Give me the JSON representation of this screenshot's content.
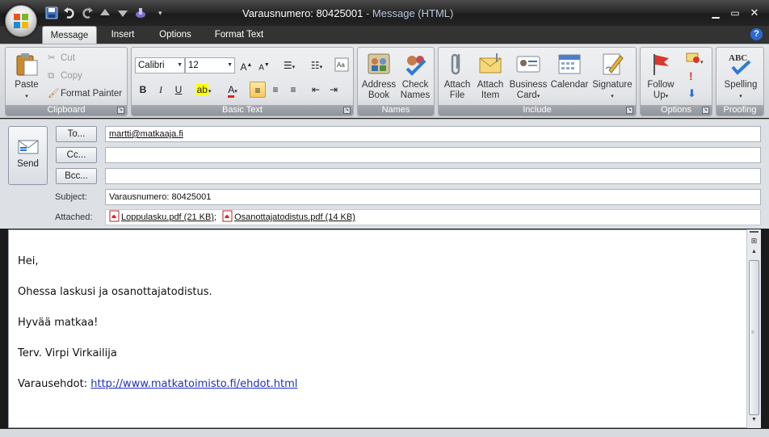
{
  "window": {
    "title": "Varausnumero: 80425001",
    "title_suffix": " - Message (HTML)"
  },
  "quick_access": [
    "save-icon",
    "undo-icon",
    "redo-icon",
    "up-icon",
    "down-icon",
    "customize-icon"
  ],
  "tabs": [
    {
      "label": "Message",
      "active": true
    },
    {
      "label": "Insert",
      "active": false
    },
    {
      "label": "Options",
      "active": false
    },
    {
      "label": "Format Text",
      "active": false
    }
  ],
  "ribbon": {
    "clipboard": {
      "label": "Clipboard",
      "paste": "Paste",
      "cut": "Cut",
      "copy": "Copy",
      "format_painter": "Format Painter"
    },
    "basic_text": {
      "label": "Basic Text",
      "font": "Calibri",
      "size": "12",
      "bold": "B",
      "italic": "I",
      "underline": "U"
    },
    "names": {
      "label": "Names",
      "address_book_1": "Address",
      "address_book_2": "Book",
      "check_names_1": "Check",
      "check_names_2": "Names"
    },
    "include": {
      "label": "Include",
      "attach_file_1": "Attach",
      "attach_file_2": "File",
      "attach_item_1": "Attach",
      "attach_item_2": "Item",
      "business_card_1": "Business",
      "business_card_2": "Card",
      "calendar": "Calendar",
      "signature": "Signature"
    },
    "options": {
      "label": "Options",
      "follow_up_1": "Follow",
      "follow_up_2": "Up"
    },
    "proofing": {
      "label": "Proofing",
      "spelling": "Spelling"
    }
  },
  "header": {
    "send": "Send",
    "to_button": "To...",
    "cc_button": "Cc...",
    "bcc_button": "Bcc...",
    "to_value": "martti@matkaaja.fi",
    "cc_value": "",
    "bcc_value": "",
    "subject_label": "Subject:",
    "subject_value": "Varausnumero: 80425001",
    "attached_label": "Attached:",
    "attachments": [
      {
        "name": "Loppulasku.pdf (21 KB)"
      },
      {
        "name": "Osanottajatodistus.pdf (14 KB)"
      }
    ],
    "attach_separator": ";"
  },
  "body": {
    "greeting": "Hei,",
    "line1": "Ohessa laskusi ja osanottajatodistus.",
    "line2": "Hyvää matkaa!",
    "signature": "Terv. Virpi Virkailija",
    "terms_label": "Varausehdot: ",
    "terms_link": "http://www.matkatoimisto.fi/ehdot.html"
  },
  "colors": {
    "titlebar": "#1c1c1c",
    "ribbon": "#e3e5e8",
    "group_label": "#8f949b",
    "link": "#1f2fbf"
  }
}
